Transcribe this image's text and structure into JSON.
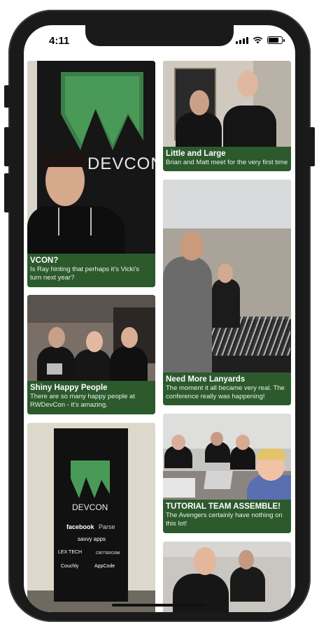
{
  "status": {
    "time": "4:11",
    "battery_level": 0.9
  },
  "icons": [
    "wifi-icon",
    "signal-icon",
    "battery-icon"
  ],
  "cards": [
    {
      "title": "VCON?",
      "desc": "Is Ray hinting that perhaps it's Vicki's turn next year?",
      "banner": "DEVCON"
    },
    {
      "title": "Little and Large",
      "desc": "Brian and Matt meet for the very first time"
    },
    {
      "title": "Need More Lanyards",
      "desc": "The moment it all became very real. The conference really was happening!"
    },
    {
      "title": "Shiny Happy People",
      "desc": "There are so many happy people at RWDevCon - it's amazing."
    },
    {
      "title": "TUTORIAL TEAM ASSEMBLE!",
      "desc": "The Avengers certainly have nothing on this lot!"
    },
    {
      "title": "",
      "desc": "",
      "banner": "DEVCON",
      "sponsors": [
        "facebook",
        "Parse",
        "savvy apps",
        "LEX TECH",
        "CRITTERCISM",
        "Couchly",
        "AppCode"
      ]
    },
    {
      "title": "",
      "desc": ""
    }
  ],
  "colors": {
    "caption_bg": "#2c5a2d",
    "frame": "#1a1a1a"
  }
}
